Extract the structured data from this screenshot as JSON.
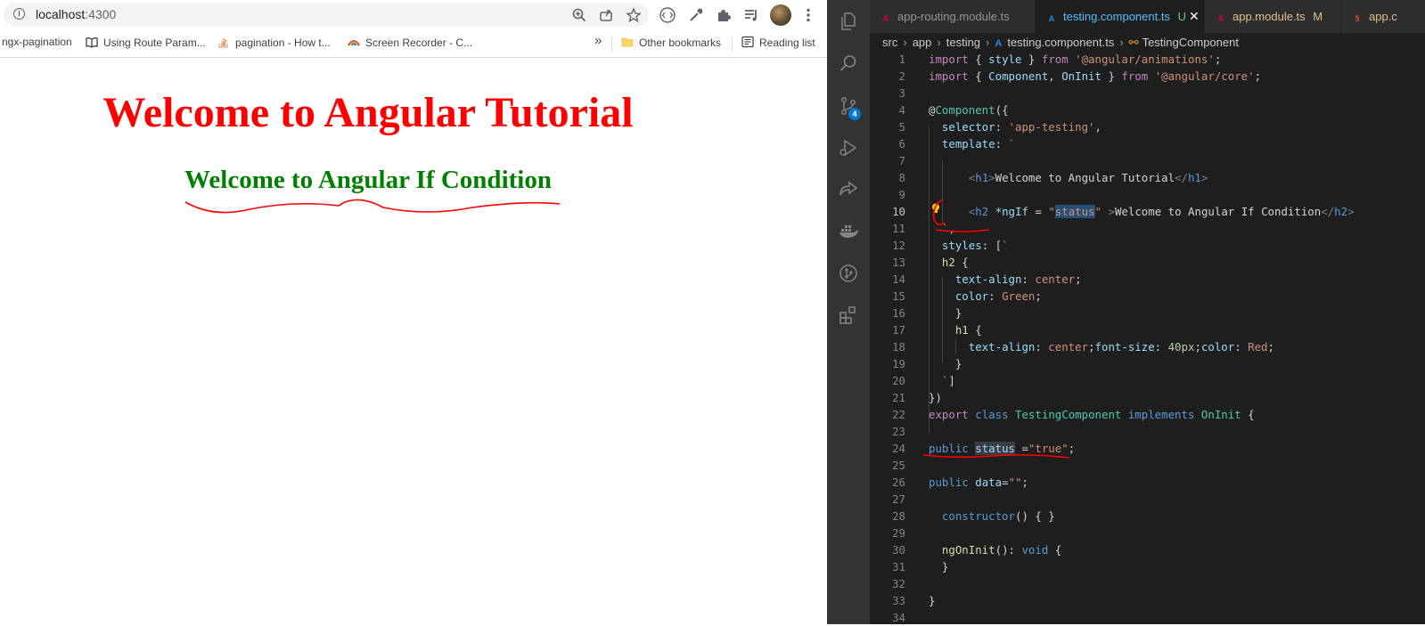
{
  "browser": {
    "url_host": "localhost",
    "url_port": ":4300",
    "bookmarks": [
      {
        "label": "ngx-pagination"
      },
      {
        "label": "Using Route Param..."
      },
      {
        "label": "pagination - How t..."
      },
      {
        "label": "Screen Recorder - C..."
      }
    ],
    "bookmarks_more": "»",
    "other_bookmarks": "Other bookmarks",
    "reading_list": "Reading list",
    "page": {
      "h1": "Welcome to Angular Tutorial",
      "h2": "Welcome to Angular If Condition"
    },
    "colors": {
      "h1": "#ff0000",
      "h2": "#008000"
    }
  },
  "vscode": {
    "scm_badge": "4",
    "tabs": [
      {
        "label": "app-routing.module.ts",
        "modified": "",
        "icon": "angular-icon"
      },
      {
        "label": "testing.component.ts",
        "modified": "U",
        "icon": "angular-component-icon"
      },
      {
        "label": "app.module.ts",
        "modified": "M",
        "icon": "angular-icon"
      },
      {
        "label": "app.c",
        "modified": "",
        "icon": "html-icon"
      }
    ],
    "breadcrumb": [
      "src",
      "app",
      "testing",
      "testing.component.ts",
      "TestingComponent"
    ],
    "code_lines": [
      {
        "n": "1",
        "text": "import { style } from '@angular/animations';"
      },
      {
        "n": "2",
        "text": "import { Component, OnInit } from '@angular/core';"
      },
      {
        "n": "3",
        "text": ""
      },
      {
        "n": "4",
        "text": "@Component({"
      },
      {
        "n": "5",
        "text": "  selector: 'app-testing',"
      },
      {
        "n": "6",
        "text": "  template: `"
      },
      {
        "n": "7",
        "text": ""
      },
      {
        "n": "8",
        "text": "      <h1>Welcome to Angular Tutorial</h1>"
      },
      {
        "n": "9",
        "text": ""
      },
      {
        "n": "10",
        "text": "      <h2 *ngIf = \"status\" >Welcome to Angular If Condition</h2>"
      },
      {
        "n": "11",
        "text": "  `,"
      },
      {
        "n": "12",
        "text": "  styles: [`"
      },
      {
        "n": "13",
        "text": "  h2 {"
      },
      {
        "n": "14",
        "text": "    text-align: center;"
      },
      {
        "n": "15",
        "text": "    color: Green;"
      },
      {
        "n": "16",
        "text": "    }"
      },
      {
        "n": "17",
        "text": "    h1 {"
      },
      {
        "n": "18",
        "text": "      text-align: center;font-size: 40px;color: Red;"
      },
      {
        "n": "19",
        "text": "    }"
      },
      {
        "n": "20",
        "text": "  `]"
      },
      {
        "n": "21",
        "text": "})"
      },
      {
        "n": "22",
        "text": "export class TestingComponent implements OnInit {"
      },
      {
        "n": "23",
        "text": ""
      },
      {
        "n": "24",
        "text": "public status =\"true\";"
      },
      {
        "n": "25",
        "text": ""
      },
      {
        "n": "26",
        "text": "public data=\"\";"
      },
      {
        "n": "27",
        "text": ""
      },
      {
        "n": "28",
        "text": "  constructor() { }"
      },
      {
        "n": "29",
        "text": ""
      },
      {
        "n": "30",
        "text": "  ngOnInit(): void {"
      },
      {
        "n": "31",
        "text": "  }"
      },
      {
        "n": "32",
        "text": ""
      },
      {
        "n": "33",
        "text": "}"
      },
      {
        "n": "34",
        "text": ""
      }
    ],
    "colors": {
      "keyword": "#c586c0",
      "string": "#ce9178",
      "type": "#4ec9b0",
      "background": "#1e1e1e",
      "selection": "#264f78"
    }
  },
  "annotations": {
    "color": "#ff0000"
  }
}
